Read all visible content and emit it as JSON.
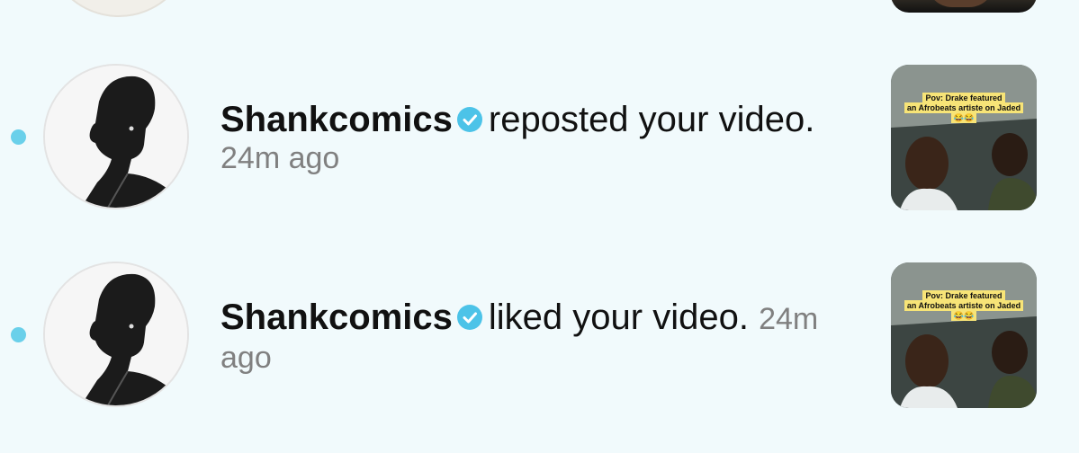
{
  "colors": {
    "background": "#f1fafc",
    "unread_dot": "#6ad0ea",
    "verified_badge": "#4cc3e8",
    "timestamp": "#808080"
  },
  "notifications": [
    {
      "username": "Shankcomics",
      "verified": true,
      "unread": true,
      "action": "reposted your video.",
      "time": "24m ago",
      "thumbnail": {
        "caption_line1": "Pov: Drake featured",
        "caption_line2": "an Afrobeats artiste on Jaded😂😂"
      }
    },
    {
      "username": "Shankcomics",
      "verified": true,
      "unread": true,
      "action": "liked your video.",
      "time_part1": "24m",
      "time_part2": "ago",
      "thumbnail": {
        "caption_line1": "Pov: Drake featured",
        "caption_line2": "an Afrobeats artiste on Jaded😂😂"
      }
    }
  ]
}
